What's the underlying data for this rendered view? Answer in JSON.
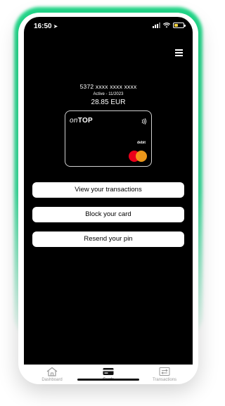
{
  "status_bar": {
    "time": "16:50",
    "battery_color": "#f6d33d"
  },
  "card": {
    "number": "5372 xxxx xxxx xxxx",
    "status": "Active - 11/2023",
    "balance": "28.85 EUR",
    "brand_light": "on",
    "brand_bold": "TOP",
    "type": "debit",
    "network_icon": "mastercard-logo"
  },
  "actions": [
    {
      "label": "View your transactions"
    },
    {
      "label": "Block your card"
    },
    {
      "label": "Resend your pin"
    }
  ],
  "tabs": [
    {
      "label": "Dashboard",
      "icon": "home-icon",
      "active": false
    },
    {
      "label": "Cards",
      "icon": "card-icon",
      "active": true
    },
    {
      "label": "Transactions",
      "icon": "transfer-icon",
      "active": false
    }
  ],
  "colors": {
    "accent": "#22d98a",
    "screen_bg": "#000000"
  }
}
